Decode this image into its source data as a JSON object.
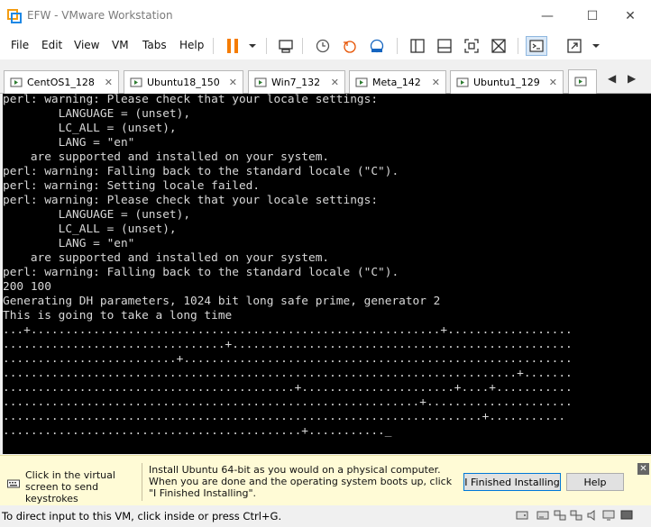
{
  "window": {
    "title": "EFW - VMware Workstation",
    "minimize_glyph": "—",
    "maximize_glyph": "☐",
    "close_glyph": "✕"
  },
  "menu": {
    "items": [
      "File",
      "Edit",
      "View",
      "VM",
      "Tabs",
      "Help"
    ]
  },
  "toolbar": {
    "icons": [
      "pause-icon",
      "dropdown-arrow-icon",
      "send-ctrl-alt-del-icon",
      "snapshot-icon",
      "revert-snapshot-icon",
      "snapshot-manager-icon",
      "show-library-icon",
      "thumbnail-bar-icon",
      "full-screen-icon",
      "unity-icon",
      "console-view-icon",
      "stretch-icon",
      "dropdown-arrow-icon"
    ]
  },
  "tabs": [
    {
      "label": "CentOS1_128",
      "close": "✕"
    },
    {
      "label": "Ubuntu18_150",
      "close": "✕"
    },
    {
      "label": "Win7_132",
      "close": "✕"
    },
    {
      "label": "Meta_142",
      "close": "✕"
    },
    {
      "label": "Ubuntu1_129",
      "close": "✕"
    }
  ],
  "tab_nav": {
    "prev": "◀",
    "next": "▶"
  },
  "console": {
    "lines": [
      "perl: warning: Please check that your locale settings:",
      "        LANGUAGE = (unset),",
      "        LC_ALL = (unset),",
      "        LANG = \"en\"",
      "    are supported and installed on your system.",
      "perl: warning: Falling back to the standard locale (\"C\").",
      "perl: warning: Setting locale failed.",
      "perl: warning: Please check that your locale settings:",
      "        LANGUAGE = (unset),",
      "        LC_ALL = (unset),",
      "        LANG = \"en\"",
      "    are supported and installed on your system.",
      "perl: warning: Falling back to the standard locale (\"C\").",
      "200 100",
      "Generating DH parameters, 1024 bit long safe prime, generator 2",
      "This is going to take a long time",
      "...+...........................................................+..................",
      "................................+.................................................",
      ".........................+........................................................",
      "..........................................................................+.......",
      "..........................................+......................+....+...........",
      "............................................................+.....................",
      ".....................................................................+...........",
      "...........................................+..........._"
    ]
  },
  "hint": {
    "left_text": "Click in the virtual screen to send keystrokes",
    "main_text": "Install Ubuntu 64-bit as you would on a physical computer. When you are done and the operating system boots up, click \"I Finished Installing\".",
    "finished_button": "I Finished Installing",
    "help_button": "Help",
    "close_glyph": "✕"
  },
  "status": {
    "text": "To direct input to this VM, click inside or press Ctrl+G.",
    "icons": [
      "hard-disk-icon",
      "cd-rom-icon",
      "network-adapter-icon",
      "usb-icon",
      "sound-icon",
      "display-icon",
      "message-icon"
    ]
  }
}
